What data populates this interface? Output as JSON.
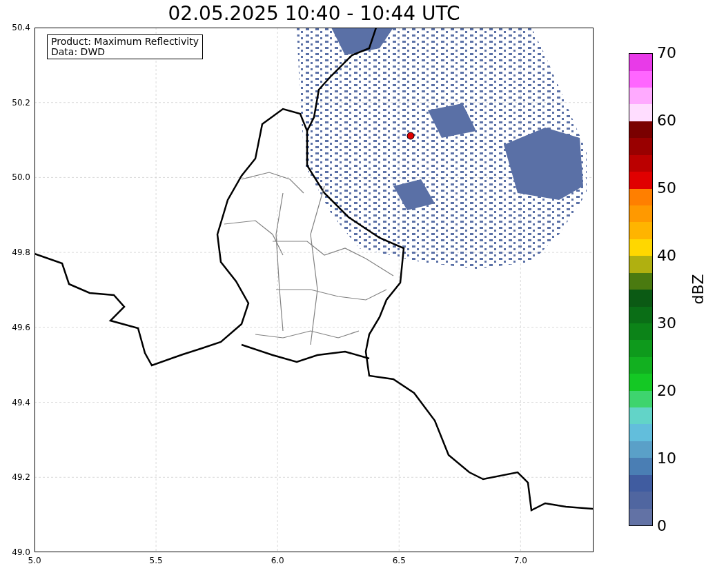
{
  "title": "02.05.2025 10:40 - 10:44 UTC",
  "info_box": [
    "Product: Maximum Reflectivity",
    "Data: DWD"
  ],
  "x_ticks": [
    "5.0",
    "5.5",
    "6.0",
    "6.5",
    "7.0"
  ],
  "y_ticks": [
    "50.4",
    "50.2",
    "50.0",
    "49.8",
    "49.6",
    "49.4",
    "49.2",
    "49.0"
  ],
  "colorbar": {
    "label": "dBZ",
    "ticks": [
      "70",
      "60",
      "50",
      "40",
      "30",
      "20",
      "10",
      "0"
    ],
    "bins": [
      {
        "color": "#6272a5"
      },
      {
        "color": "#5066a0"
      },
      {
        "color": "#405ca0"
      },
      {
        "color": "#4a7eb4"
      },
      {
        "color": "#5aa0c8"
      },
      {
        "color": "#62bedc"
      },
      {
        "color": "#62d4c8"
      },
      {
        "color": "#3ed46e"
      },
      {
        "color": "#14c824"
      },
      {
        "color": "#12b020"
      },
      {
        "color": "#0e9a1c"
      },
      {
        "color": "#0c8318"
      },
      {
        "color": "#0a6e16"
      },
      {
        "color": "#0b5a14"
      },
      {
        "color": "#4a7a10"
      },
      {
        "color": "#b0b010"
      },
      {
        "color": "#ffd700"
      },
      {
        "color": "#ffb400"
      },
      {
        "color": "#ff9900"
      },
      {
        "color": "#ff7f00"
      },
      {
        "color": "#e00000"
      },
      {
        "color": "#bb0000"
      },
      {
        "color": "#990000"
      },
      {
        "color": "#7a0000"
      },
      {
        "color": "#ffddff"
      },
      {
        "color": "#ffaaff"
      },
      {
        "color": "#ff66ff"
      },
      {
        "color": "#e83ae8"
      }
    ]
  }
}
